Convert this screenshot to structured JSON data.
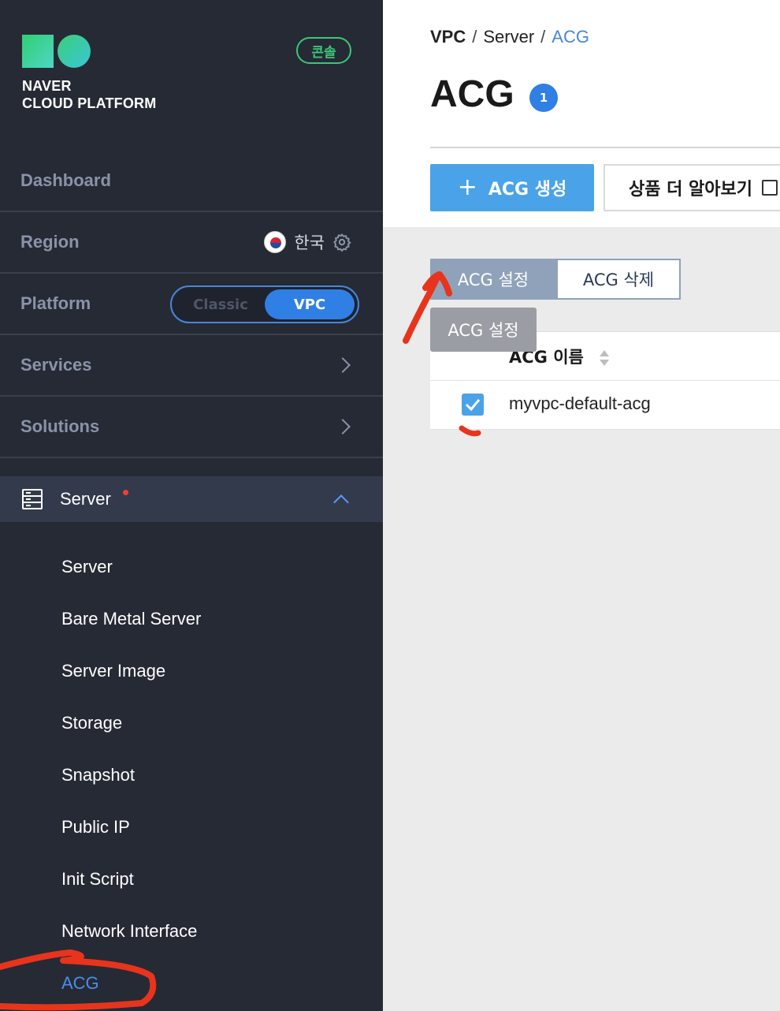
{
  "brand": {
    "line1": "NAVER",
    "line2": "CLOUD PLATFORM",
    "console_badge": "콘솔",
    "colors": {
      "green": "#3cc777",
      "teal": "#4fd6c4"
    }
  },
  "sidebar": {
    "dashboard": "Dashboard",
    "region": {
      "label": "Region",
      "value": "한국"
    },
    "platform": {
      "label": "Platform",
      "options": [
        "Classic",
        "VPC"
      ],
      "selected": "VPC"
    },
    "services": "Services",
    "solutions": "Solutions",
    "server_group": {
      "title": "Server",
      "items": [
        "Server",
        "Bare Metal Server",
        "Server Image",
        "Storage",
        "Snapshot",
        "Public IP",
        "Init Script",
        "Network Interface",
        "ACG"
      ],
      "active_item": "ACG"
    }
  },
  "breadcrumb": {
    "items": [
      "VPC",
      "Server",
      "ACG"
    ],
    "separator": "/"
  },
  "page": {
    "title": "ACG",
    "count": "1"
  },
  "toolbar": {
    "create_icon": "+",
    "create_label": "ACG 생성",
    "learn_more_label": "상품 더 알아보기"
  },
  "actions": {
    "set_label": "ACG 설정",
    "delete_label": "ACG 삭제",
    "tooltip": "ACG 설정"
  },
  "table": {
    "columns": [
      "ACG 이름"
    ],
    "rows": [
      {
        "checked": true,
        "name": "myvpc-default-acg"
      }
    ]
  },
  "colors": {
    "sidebar_bg": "#262a35",
    "accent_blue": "#2f7fe5",
    "button_blue": "#4aa3e8",
    "annotation_red": "#e8341c"
  }
}
